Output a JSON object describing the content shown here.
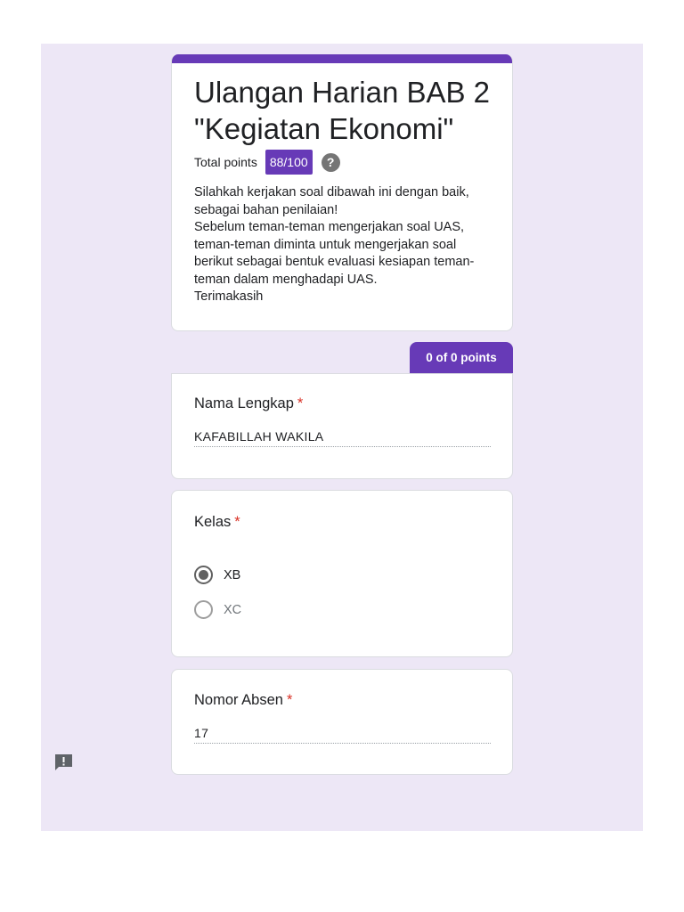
{
  "form": {
    "title": "Ulangan Harian BAB 2 \"Kegiatan Ekonomi\"",
    "total_points_label": "Total points",
    "score": "88/100",
    "help_icon": "?",
    "description": [
      "Silahkah kerjakan soal dibawah ini dengan baik,",
      "sebagai bahan penilaian!",
      "Sebelum teman-teman mengerjakan soal UAS,",
      "teman-teman diminta untuk mengerjakan soal",
      "berikut sebagai bentuk evaluasi kesiapan teman-",
      "teman dalam menghadapi UAS.",
      "Terimakasih"
    ]
  },
  "section": {
    "points_label": "0 of 0 points"
  },
  "questions": {
    "nama": {
      "title": "Nama Lengkap",
      "required_mark": "*",
      "answer": "KAFABILLAH WAKILA"
    },
    "kelas": {
      "title": "Kelas",
      "required_mark": "*",
      "options": [
        {
          "label": "XB",
          "selected": true
        },
        {
          "label": "XC",
          "selected": false
        }
      ]
    },
    "absen": {
      "title": "Nomor Absen",
      "required_mark": "*",
      "answer": "17"
    }
  },
  "icons": {
    "help": "help-circle-icon",
    "feedback": "report-feedback-icon"
  },
  "colors": {
    "accent": "#673ab7",
    "background": "#ede7f6",
    "required": "#d93025"
  }
}
